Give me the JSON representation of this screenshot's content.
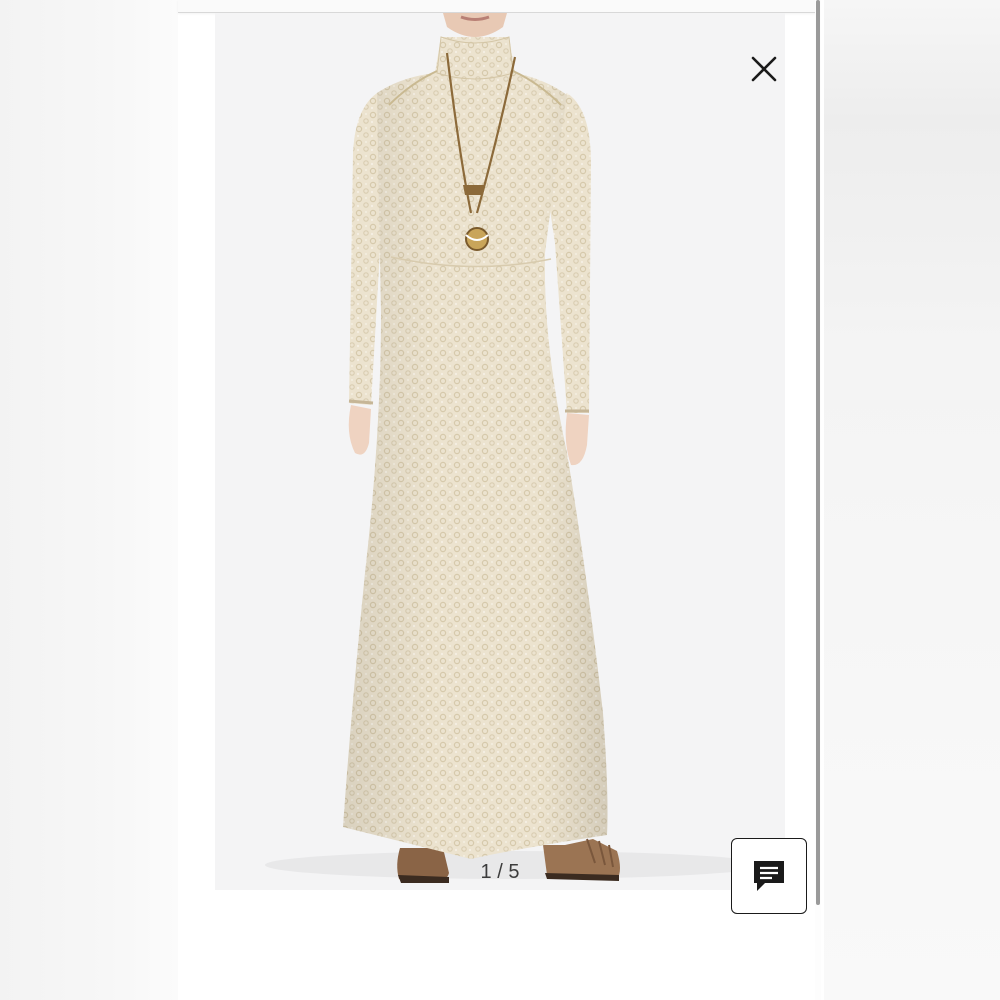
{
  "viewer": {
    "image_subject": "product-photo",
    "counter": {
      "current": "1",
      "separator": " / ",
      "total": "5"
    }
  },
  "controls": {
    "close_icon": "close-icon",
    "chat_icon": "chat-message-icon"
  },
  "colors": {
    "background": "#f4f4f5",
    "dress": "#ece3cf",
    "icon": "#1a1a1a"
  }
}
